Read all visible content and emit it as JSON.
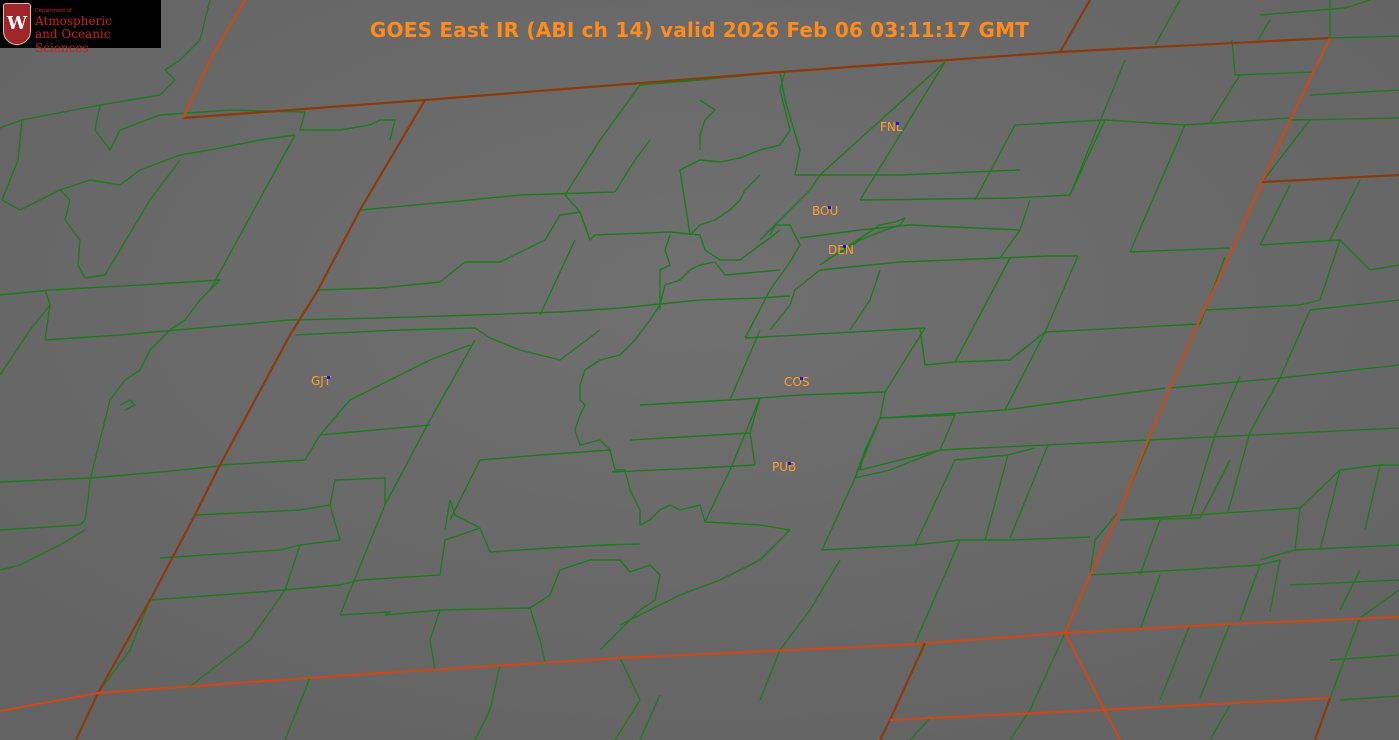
{
  "title": "GOES East IR (ABI ch 14) valid 2026 Feb 06 03:11:17 GMT",
  "logo": {
    "seal_letter": "W",
    "line_small": "Department of",
    "line1": "Atmospheric",
    "line2": "and Oceanic Sciences"
  },
  "stations": [
    {
      "id": "FNL"
    },
    {
      "id": "BOU"
    },
    {
      "id": "DEN"
    },
    {
      "id": "GJT"
    },
    {
      "id": "COS"
    },
    {
      "id": "PUB"
    }
  ],
  "colors": {
    "state_border": "#8b3a0a",
    "state_border_highlight": "#c84a1a",
    "county_border": "#1f7a1f",
    "station_label": "#ff9d2e",
    "station_marker": "#1010ff",
    "title": "#ff8c1a",
    "background": "#666666"
  }
}
